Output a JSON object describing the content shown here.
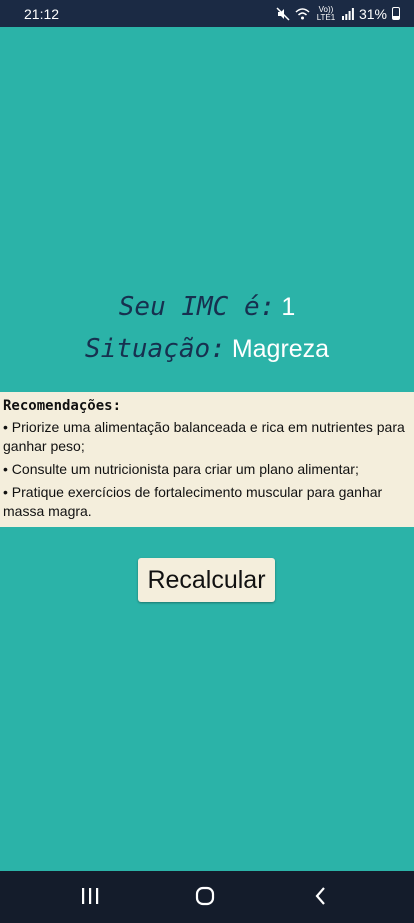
{
  "status_bar": {
    "time": "21:12",
    "lte_label": "Vo)) LTE1",
    "battery": "31%",
    "icons": [
      "mute-icon",
      "wifi-icon",
      "signal-icon",
      "battery-icon"
    ]
  },
  "result": {
    "imc_label": "Seu IMC é:",
    "imc_value": "1",
    "situation_label": "Situação:",
    "situation_value": "Magreza"
  },
  "recommendations": {
    "title": "Recomendações:",
    "items": [
      "• Priorize uma alimentação balanceada e rica em nutrientes para ganhar peso;",
      "• Consulte um nutricionista para criar um plano alimentar;",
      "• Pratique exercícios de fortalecimento muscular para ganhar massa magra."
    ]
  },
  "actions": {
    "recalculate_label": "Recalcular"
  },
  "nav_bar": {
    "buttons": [
      "recents-icon",
      "home-icon",
      "back-icon"
    ]
  },
  "colors": {
    "background": "#2bb3a8",
    "status_bar": "#1b2a44",
    "label_text": "#17304f",
    "panel": "#f4eedc",
    "nav_bar": "#141c2b"
  }
}
